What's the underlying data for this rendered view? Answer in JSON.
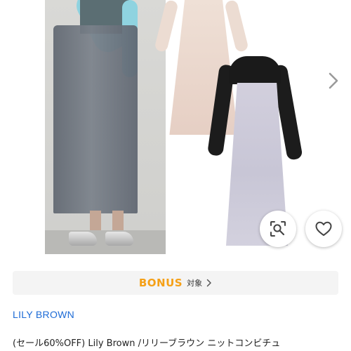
{
  "product": {
    "image_alt": "LILY BROWN ニットコンビチュールドレス",
    "next_icon": "chevron-right-icon",
    "zoom_icon": "zoom-search-icon",
    "like_icon": "heart-outline-icon"
  },
  "bonus": {
    "word": "BONUS",
    "label": "対象",
    "word_color": "#f5a017",
    "chevron_icon": "chevron-right-icon"
  },
  "brand": {
    "name": "LILY BROWN",
    "color": "#1d6bd6"
  },
  "title": "(セール60%OFF)  Lily Brown /リリーブラウン ニットコンビチュ"
}
